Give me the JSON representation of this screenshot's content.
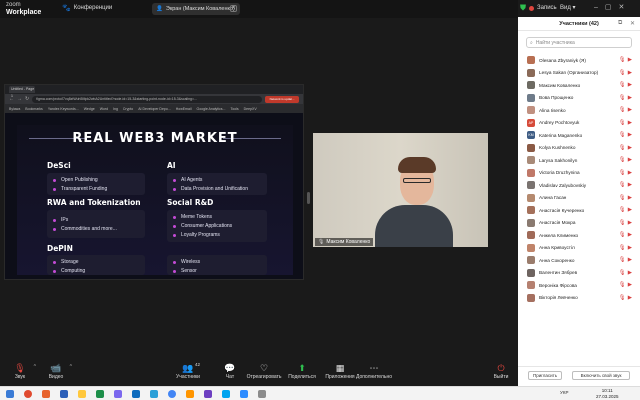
{
  "app": {
    "brand_top": "zoom",
    "brand_bottom": "Workplace",
    "conferences_label": "Конференции",
    "speaker_label": "Экран (Максим Коваленко)",
    "record_label": "Запись",
    "view_label": "Вид"
  },
  "browser": {
    "tabs": [
      "Untitled - Page 1"
    ],
    "url": "figma.com/proto/l7vq8ztWuh5Mpk2wbA2Untitled?node-id=15-3&starting-point-node-id=15-3&scaling=...",
    "ext_label": "Network is updat...",
    "bookmarks": [
      "Bylawa",
      "Bookmarks",
      "Yandex Keywords...",
      "Wedge",
      "Word",
      "Ing",
      "Crypto",
      "AI Developer Depo...",
      "HowEmail",
      "Google Analytics...",
      "Tools",
      "DeepXV"
    ]
  },
  "slide": {
    "title": "REAL WEB3 MARKET",
    "sections": [
      {
        "key": "desci",
        "title": "DeSci",
        "items": [
          "Open Publishing",
          "Transparent Funding"
        ]
      },
      {
        "key": "ai",
        "title": "AI",
        "items": [
          "AI Agents",
          "Data Provision and Unification"
        ]
      },
      {
        "key": "rwa",
        "title": "RWA and Tokenization",
        "items": [
          "IPs",
          "Commodities and more..."
        ]
      },
      {
        "key": "social",
        "title": "Social R&D",
        "items": [
          "Meme Tokens",
          "Consumer Applications",
          "Loyalty Programs"
        ]
      },
      {
        "key": "depin",
        "title": "DePIN",
        "items": [
          "Storage",
          "Computing"
        ]
      },
      {
        "key": "depin2",
        "title": "",
        "items": [
          "Wireless",
          "Sensor"
        ]
      }
    ]
  },
  "camera": {
    "name": "Максим Коваленко"
  },
  "participants": {
    "title": "Участники (42)",
    "search_placeholder": "Найти участника",
    "list": [
      {
        "name": "Olesana Zbyraniyk (Я)",
        "avatar": "",
        "color": "#b86f52"
      },
      {
        "name": "Lesya Sakan (Организатор)",
        "avatar": "",
        "color": "#8a6a58"
      },
      {
        "name": "Максим Коваленко",
        "avatar": "",
        "color": "#6d6a62"
      },
      {
        "name": "Вова Прощенко",
        "avatar": "",
        "color": "#6e7b8a"
      },
      {
        "name": "Alina Iisenko",
        "avatar": "",
        "color": "#c09080"
      },
      {
        "name": "Andrey Pochtovyuk",
        "avatar": "AP",
        "color": "#d64b3a"
      },
      {
        "name": "Katerina Maganenko",
        "avatar": "KM",
        "color": "#3e5c84"
      },
      {
        "name": "Kolya Kushnenko",
        "avatar": "",
        "color": "#8b5a45"
      },
      {
        "name": "Larysa Sakhonilyn",
        "avatar": "",
        "color": "#a88a78"
      },
      {
        "name": "Victoria Druzhynina",
        "avatar": "",
        "color": "#c07868"
      },
      {
        "name": "Vladislav Zalyubovskiy",
        "avatar": "",
        "color": "#7a7370"
      },
      {
        "name": "Алина Гасан",
        "avatar": "",
        "color": "#b58a6f"
      },
      {
        "name": "Анастасія Кучеренко",
        "avatar": "",
        "color": "#a4705a"
      },
      {
        "name": "Анастасія Мокра",
        "avatar": "",
        "color": "#8a7a70"
      },
      {
        "name": "Анжела Клименко",
        "avatar": "",
        "color": "#a06a58"
      },
      {
        "name": "Анна Кривоустіл",
        "avatar": "",
        "color": "#c0846a"
      },
      {
        "name": "Анна Сокоренко",
        "avatar": "",
        "color": "#9a7c6c"
      },
      {
        "name": "Валентин Зябрев",
        "avatar": "",
        "color": "#6e6460"
      },
      {
        "name": "Вероніка Фірсова",
        "avatar": "",
        "color": "#b58070"
      },
      {
        "name": "Вікторія Левченко",
        "avatar": "",
        "color": "#a57060"
      }
    ],
    "invite_label": "Пригласить",
    "unmute_all_label": "Включить свой звук"
  },
  "controls": {
    "audio": "Звук",
    "video": "Видео",
    "participants": "Участники",
    "participants_count": "42",
    "chat": "Чат",
    "react": "Отреагировать",
    "share": "Поделиться",
    "apps": "Приложения",
    "more": "Дополнительно",
    "leave": "Выйти"
  },
  "taskbar": {
    "lang": "УКР",
    "time": "10:11",
    "date": "27.03.2025"
  }
}
